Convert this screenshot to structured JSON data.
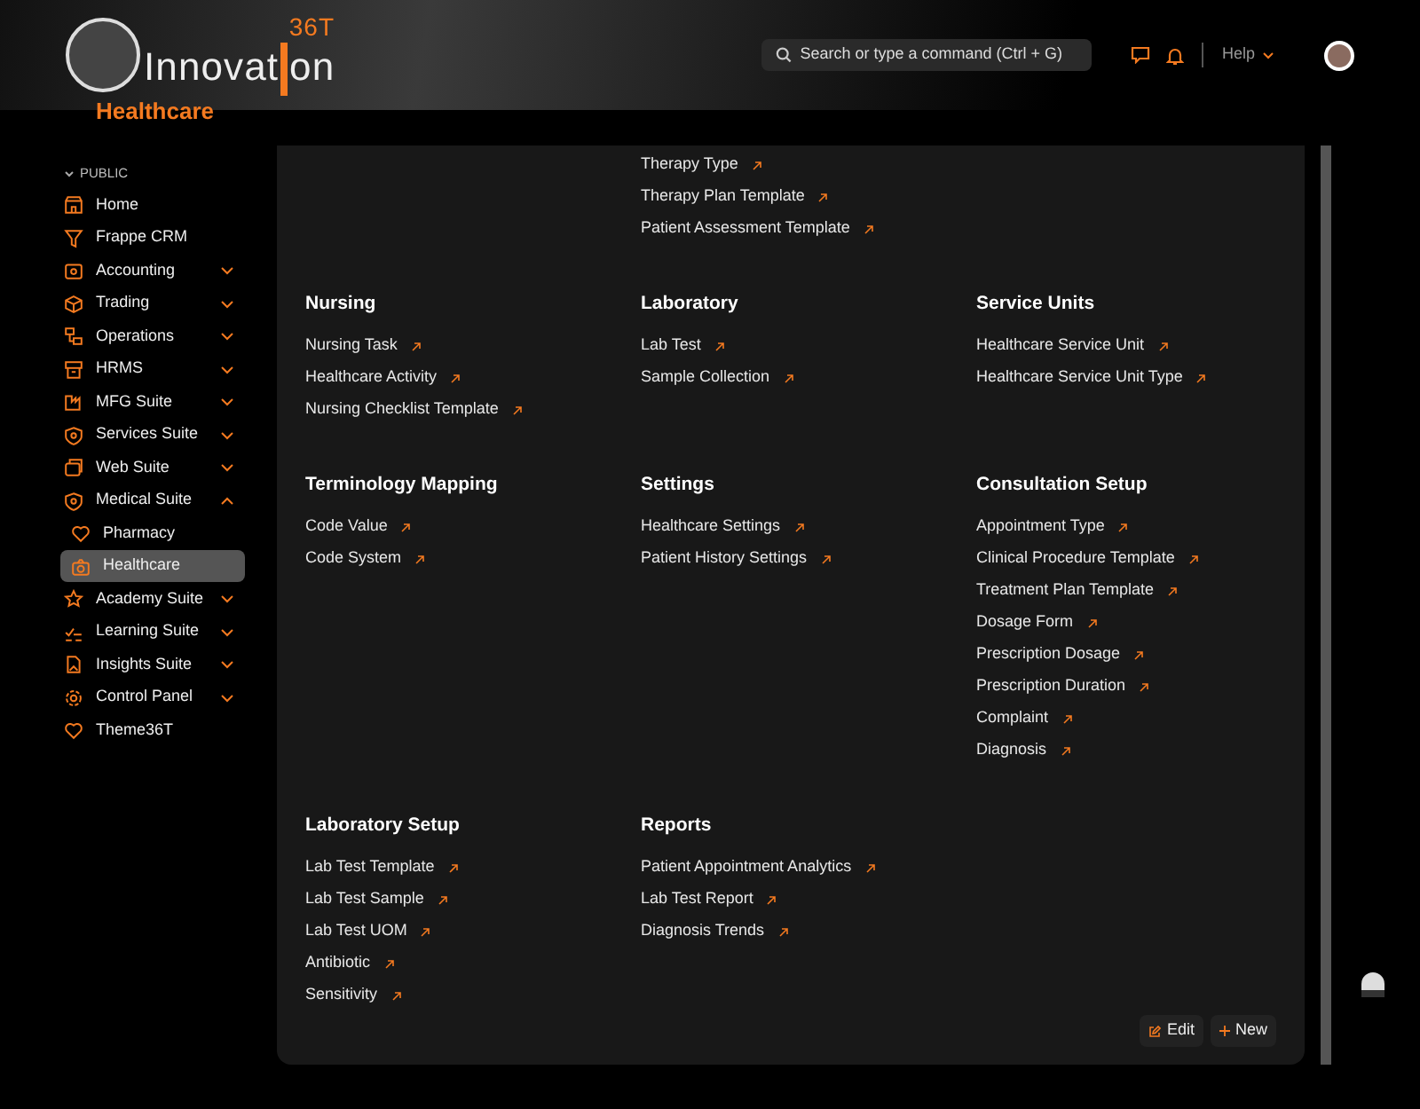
{
  "brand": {
    "name_prefix": "Innovat",
    "name_suffix": "on",
    "mark": "36T"
  },
  "search": {
    "placeholder": "Search or type a command (Ctrl + G)"
  },
  "help": "Help",
  "page_title": "Healthcare",
  "sidebar": {
    "section": "PUBLIC",
    "items": [
      {
        "label": "Home",
        "expandable": false,
        "selected": false
      },
      {
        "label": "Frappe CRM",
        "expandable": false,
        "selected": false
      },
      {
        "label": "Accounting",
        "expandable": true,
        "expanded": false,
        "selected": false
      },
      {
        "label": "Trading",
        "expandable": true,
        "expanded": false,
        "selected": false
      },
      {
        "label": "Operations",
        "expandable": true,
        "expanded": false,
        "selected": false
      },
      {
        "label": "HRMS",
        "expandable": true,
        "expanded": false,
        "selected": false
      },
      {
        "label": "MFG Suite",
        "expandable": true,
        "expanded": false,
        "selected": false
      },
      {
        "label": "Services Suite",
        "expandable": true,
        "expanded": false,
        "selected": false
      },
      {
        "label": "Web Suite",
        "expandable": true,
        "expanded": false,
        "selected": false
      },
      {
        "label": "Medical Suite",
        "expandable": true,
        "expanded": true,
        "selected": false,
        "children": [
          {
            "label": "Pharmacy",
            "selected": false
          },
          {
            "label": "Healthcare",
            "selected": true
          }
        ]
      },
      {
        "label": "Academy Suite",
        "expandable": true,
        "expanded": false,
        "selected": false
      },
      {
        "label": "Learning Suite",
        "expandable": true,
        "expanded": false,
        "selected": false
      },
      {
        "label": "Insights Suite",
        "expandable": true,
        "expanded": false,
        "selected": false
      },
      {
        "label": "Control Panel",
        "expandable": true,
        "expanded": false,
        "selected": false
      },
      {
        "label": "Theme36T",
        "expandable": false,
        "selected": false
      }
    ]
  },
  "card_rows": [
    [
      {
        "kind": "blank"
      },
      {
        "kind": "group",
        "links": [
          "Therapy Type",
          "Therapy Plan Template",
          "Patient Assessment Template"
        ]
      },
      {
        "kind": "blank"
      }
    ],
    [
      {
        "kind": "group",
        "title": "Nursing",
        "links": [
          "Nursing Task",
          "Healthcare Activity",
          "Nursing Checklist Template"
        ]
      },
      {
        "kind": "group",
        "title": "Laboratory",
        "links": [
          "Lab Test",
          "Sample Collection"
        ]
      },
      {
        "kind": "group",
        "title": "Service Units",
        "links": [
          "Healthcare Service Unit",
          "Healthcare Service Unit Type"
        ]
      }
    ],
    [
      {
        "kind": "group",
        "title": "Terminology Mapping",
        "links": [
          "Code Value",
          "Code System"
        ]
      },
      {
        "kind": "group",
        "title": "Settings",
        "links": [
          "Healthcare Settings",
          "Patient History Settings"
        ]
      },
      {
        "kind": "group",
        "title": "Consultation Setup",
        "links": [
          "Appointment Type",
          "Clinical Procedure Template",
          "Treatment Plan Template",
          "Dosage Form",
          "Prescription Dosage",
          "Prescription Duration",
          "Complaint",
          "Diagnosis"
        ]
      }
    ],
    [
      {
        "kind": "group",
        "title": "Laboratory Setup",
        "links": [
          "Lab Test Template",
          "Lab Test Sample",
          "Lab Test UOM",
          "Antibiotic",
          "Sensitivity"
        ]
      },
      {
        "kind": "group",
        "title": "Reports",
        "links": [
          "Patient Appointment Analytics",
          "Lab Test Report",
          "Diagnosis Trends"
        ]
      },
      {
        "kind": "blank"
      }
    ]
  ],
  "actions": [
    {
      "kind": "edit",
      "label": "Edit"
    },
    {
      "kind": "new",
      "label": "New"
    }
  ]
}
